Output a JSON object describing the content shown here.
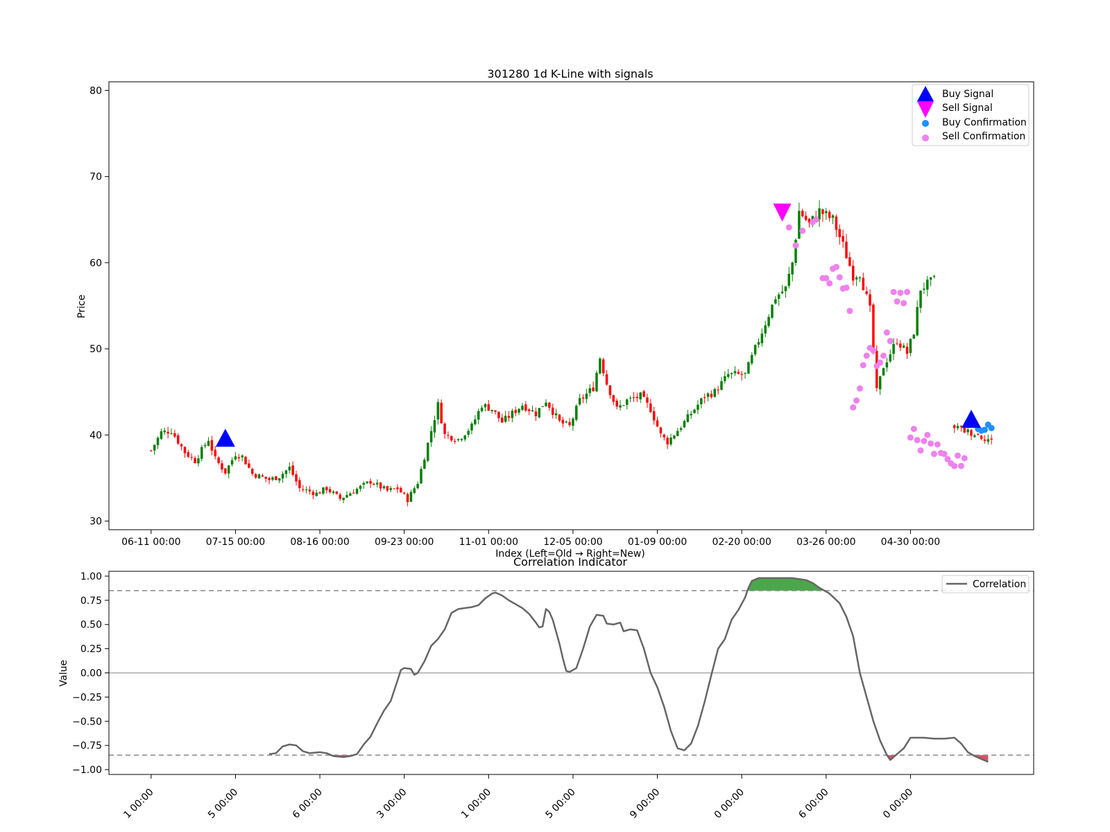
{
  "chart_data": [
    {
      "type": "candlestick",
      "title": "301280 1d K-Line with signals",
      "xlabel": "Index (Left=Old → Right=New)",
      "ylabel": "Price",
      "ylim": [
        29,
        81
      ],
      "yticks": [
        30,
        40,
        50,
        60,
        70,
        80
      ],
      "xticks": [
        {
          "i": 0,
          "label": "06-11 00:00"
        },
        {
          "i": 25,
          "label": "07-15 00:00"
        },
        {
          "i": 50,
          "label": "08-16 00:00"
        },
        {
          "i": 75,
          "label": "09-23 00:00"
        },
        {
          "i": 100,
          "label": "11-01 00:00"
        },
        {
          "i": 125,
          "label": "12-05 00:00"
        },
        {
          "i": 150,
          "label": "01-09 00:00"
        },
        {
          "i": 175,
          "label": "02-20 00:00"
        },
        {
          "i": 200,
          "label": "03-26 00:00"
        },
        {
          "i": 225,
          "label": "04-30 00:00"
        }
      ],
      "xlim": [
        -12.5,
        261.5
      ],
      "candle_count": 250,
      "candle_anchors": [
        [
          0,
          38.2
        ],
        [
          3,
          40.3
        ],
        [
          6,
          40.5
        ],
        [
          10,
          38
        ],
        [
          13,
          37
        ],
        [
          17,
          39.5
        ],
        [
          19,
          37.2
        ],
        [
          22,
          35.7
        ],
        [
          25,
          37.8
        ],
        [
          27,
          37.5
        ],
        [
          30,
          35.5
        ],
        [
          35,
          34.8
        ],
        [
          38,
          35.2
        ],
        [
          41,
          36.2
        ],
        [
          44,
          33.8
        ],
        [
          49,
          33.2
        ],
        [
          52,
          33.8
        ],
        [
          56,
          32.6
        ],
        [
          60,
          33.5
        ],
        [
          65,
          34.6
        ],
        [
          70,
          33.5
        ],
        [
          73,
          33.8
        ],
        [
          76,
          32.5
        ],
        [
          79,
          34.5
        ],
        [
          82,
          39
        ],
        [
          85,
          43.5
        ],
        [
          87,
          40
        ],
        [
          91,
          39.5
        ],
        [
          95,
          41
        ],
        [
          98,
          43.5
        ],
        [
          101,
          43
        ],
        [
          104,
          41.5
        ],
        [
          107,
          42.5
        ],
        [
          110,
          43.5
        ],
        [
          114,
          42.5
        ],
        [
          117,
          44
        ],
        [
          121,
          41.5
        ],
        [
          124,
          41
        ],
        [
          127,
          44
        ],
        [
          131,
          45.5
        ],
        [
          133,
          49
        ],
        [
          135,
          46
        ],
        [
          138,
          43
        ],
        [
          141,
          44
        ],
        [
          145,
          44.5
        ],
        [
          148,
          43
        ],
        [
          151,
          40
        ],
        [
          153,
          39.2
        ],
        [
          157,
          41
        ],
        [
          160,
          42.5
        ],
        [
          164,
          44.5
        ],
        [
          167,
          45
        ],
        [
          171,
          47
        ],
        [
          176,
          47
        ],
        [
          181,
          52
        ],
        [
          185,
          56
        ],
        [
          188,
          57
        ],
        [
          190,
          60
        ],
        [
          192,
          66
        ],
        [
          195,
          64.5
        ],
        [
          198,
          66
        ],
        [
          202,
          65
        ],
        [
          205,
          62
        ],
        [
          208,
          58.5
        ],
        [
          210,
          58.8
        ],
        [
          213,
          54.5
        ],
        [
          215,
          45
        ],
        [
          217,
          48
        ],
        [
          221,
          51
        ],
        [
          224,
          49.5
        ],
        [
          226,
          52
        ],
        [
          228,
          57
        ],
        [
          232,
          58
        ],
        [
          234,
          52
        ],
        [
          238,
          41
        ],
        [
          241,
          40.5
        ],
        [
          245,
          40
        ],
        [
          248,
          39.5
        ],
        [
          252,
          38.5
        ],
        [
          255,
          39
        ],
        [
          259,
          38.5
        ]
      ],
      "gaps": [
        [
          233,
          237
        ]
      ],
      "signals": {
        "buy_signal": [
          [
            22,
            39.6
          ],
          [
            243,
            41.8
          ]
        ],
        "sell_signal": [
          [
            187,
            65.9
          ]
        ],
        "buy_confirmation": [
          [
            245,
            40.7
          ],
          [
            246,
            40.5
          ],
          [
            247,
            40.6
          ],
          [
            248,
            41.2
          ],
          [
            249,
            40.8
          ]
        ],
        "sell_confirmation": [
          [
            189,
            64.1
          ],
          [
            191,
            62
          ],
          [
            193,
            63.7
          ],
          [
            196,
            64.7
          ],
          [
            197,
            65
          ],
          [
            199,
            58.2
          ],
          [
            200,
            58.2
          ],
          [
            201,
            57.6
          ],
          [
            202,
            59.3
          ],
          [
            203,
            59.5
          ],
          [
            204,
            58.3
          ],
          [
            205,
            57
          ],
          [
            206,
            57.1
          ],
          [
            207,
            54.4
          ],
          [
            208,
            43.2
          ],
          [
            209,
            44
          ],
          [
            210,
            45.4
          ],
          [
            211,
            48.1
          ],
          [
            212,
            49.2
          ],
          [
            213,
            50.1
          ],
          [
            214,
            49.8
          ],
          [
            215,
            48
          ],
          [
            216,
            48.4
          ],
          [
            217,
            49.2
          ],
          [
            218,
            51.9
          ],
          [
            219,
            50.9
          ],
          [
            220,
            56.6
          ],
          [
            221,
            55.5
          ],
          [
            222,
            56.5
          ],
          [
            223,
            55.3
          ],
          [
            224,
            56.6
          ],
          [
            225,
            39.7
          ],
          [
            226,
            40.7
          ],
          [
            227,
            39.4
          ],
          [
            228,
            38.2
          ],
          [
            229,
            39.3
          ],
          [
            230,
            40
          ],
          [
            231,
            39
          ],
          [
            232,
            37.8
          ],
          [
            233,
            38.9
          ],
          [
            234,
            37.9
          ],
          [
            235,
            37.8
          ],
          [
            236,
            37.2
          ],
          [
            237,
            36.7
          ],
          [
            238,
            36.4
          ],
          [
            239,
            37.6
          ],
          [
            240,
            36.4
          ],
          [
            241,
            37.3
          ]
        ]
      },
      "legend": {
        "placement": "top-right",
        "entries": [
          "Buy Signal",
          "Sell Signal",
          "Buy Confirmation",
          "Sell Confirmation"
        ]
      },
      "colors": {
        "up": "#008000",
        "down": "#ff0000",
        "buy_signal": "#0000ff",
        "sell_signal": "#ff00ff",
        "buy_confirmation": "#1e90ff",
        "sell_confirmation": "#ee82ee"
      }
    },
    {
      "type": "line",
      "title": "Correlation Indicator",
      "ylabel": "Value",
      "ylim": [
        -1.05,
        1.05
      ],
      "yticks": [
        {
          "v": 1.0,
          "label": "1.00"
        },
        {
          "v": 0.75,
          "label": "0.75"
        },
        {
          "v": 0.5,
          "label": "0.50"
        },
        {
          "v": 0.25,
          "label": "0.25"
        },
        {
          "v": 0.0,
          "label": "0.00"
        },
        {
          "v": -0.25,
          "label": "−0.25"
        },
        {
          "v": -0.5,
          "label": "−0.50"
        },
        {
          "v": -0.75,
          "label": "−0.75"
        },
        {
          "v": -1.0,
          "label": "−1.00"
        }
      ],
      "xlim": [
        -12.5,
        261.5
      ],
      "xticks": [
        {
          "i": 0,
          "label": "1 00:00"
        },
        {
          "i": 25,
          "label": "5 00:00"
        },
        {
          "i": 50,
          "label": "6 00:00"
        },
        {
          "i": 75,
          "label": "3 00:00"
        },
        {
          "i": 100,
          "label": "1 00:00"
        },
        {
          "i": 125,
          "label": "5 00:00"
        },
        {
          "i": 150,
          "label": "9 00:00"
        },
        {
          "i": 175,
          "label": "0 00:00"
        },
        {
          "i": 200,
          "label": "6 00:00"
        },
        {
          "i": 225,
          "label": "0 00:00"
        }
      ],
      "thresholds": [
        0.85,
        -0.85
      ],
      "zero_line": 0,
      "series": [
        {
          "name": "Correlation",
          "color": "#666666",
          "points": [
            [
              35,
              -0.84
            ],
            [
              37,
              -0.83
            ],
            [
              39,
              -0.76
            ],
            [
              41,
              -0.74
            ],
            [
              43,
              -0.75
            ],
            [
              45,
              -0.81
            ],
            [
              47,
              -0.83
            ],
            [
              50,
              -0.82
            ],
            [
              52,
              -0.83
            ],
            [
              54,
              -0.86
            ],
            [
              57,
              -0.87
            ],
            [
              59,
              -0.86
            ],
            [
              61,
              -0.84
            ],
            [
              63,
              -0.74
            ],
            [
              65,
              -0.66
            ],
            [
              67,
              -0.52
            ],
            [
              69,
              -0.39
            ],
            [
              71,
              -0.29
            ],
            [
              73,
              -0.08
            ],
            [
              74,
              0.03
            ],
            [
              75,
              0.05
            ],
            [
              77,
              0.04
            ],
            [
              78,
              -0.02
            ],
            [
              79,
              0.0
            ],
            [
              81,
              0.12
            ],
            [
              83,
              0.28
            ],
            [
              85,
              0.35
            ],
            [
              87,
              0.45
            ],
            [
              89,
              0.62
            ],
            [
              91,
              0.66
            ],
            [
              93,
              0.67
            ],
            [
              95,
              0.68
            ],
            [
              97,
              0.7
            ],
            [
              99,
              0.77
            ],
            [
              101,
              0.82
            ],
            [
              102,
              0.83
            ],
            [
              104,
              0.8
            ],
            [
              106,
              0.75
            ],
            [
              108,
              0.71
            ],
            [
              110,
              0.67
            ],
            [
              112,
              0.61
            ],
            [
              114,
              0.52
            ],
            [
              115,
              0.47
            ],
            [
              116,
              0.48
            ],
            [
              117,
              0.66
            ],
            [
              118,
              0.63
            ],
            [
              119,
              0.55
            ],
            [
              121,
              0.3
            ],
            [
              122,
              0.15
            ],
            [
              123,
              0.02
            ],
            [
              124,
              0.01
            ],
            [
              126,
              0.05
            ],
            [
              128,
              0.25
            ],
            [
              130,
              0.48
            ],
            [
              132,
              0.6
            ],
            [
              134,
              0.59
            ],
            [
              135,
              0.51
            ],
            [
              137,
              0.5
            ],
            [
              139,
              0.52
            ],
            [
              140,
              0.43
            ],
            [
              142,
              0.45
            ],
            [
              144,
              0.44
            ],
            [
              146,
              0.25
            ],
            [
              148,
              0.0
            ],
            [
              150,
              -0.15
            ],
            [
              152,
              -0.35
            ],
            [
              154,
              -0.6
            ],
            [
              156,
              -0.78
            ],
            [
              158,
              -0.8
            ],
            [
              160,
              -0.73
            ],
            [
              162,
              -0.55
            ],
            [
              164,
              -0.3
            ],
            [
              166,
              -0.02
            ],
            [
              168,
              0.25
            ],
            [
              170,
              0.35
            ],
            [
              172,
              0.55
            ],
            [
              174,
              0.65
            ],
            [
              176,
              0.78
            ],
            [
              177,
              0.88
            ],
            [
              178,
              0.95
            ],
            [
              180,
              0.98
            ],
            [
              185,
              0.98
            ],
            [
              190,
              0.98
            ],
            [
              194,
              0.96
            ],
            [
              196,
              0.93
            ],
            [
              198,
              0.88
            ],
            [
              201,
              0.82
            ],
            [
              204,
              0.72
            ],
            [
              206,
              0.58
            ],
            [
              208,
              0.38
            ],
            [
              210,
              0.0
            ],
            [
              212,
              -0.25
            ],
            [
              214,
              -0.5
            ],
            [
              216,
              -0.7
            ],
            [
              218,
              -0.85
            ],
            [
              219,
              -0.9
            ],
            [
              221,
              -0.84
            ],
            [
              223,
              -0.78
            ],
            [
              225,
              -0.67
            ],
            [
              229,
              -0.67
            ],
            [
              232,
              -0.68
            ],
            [
              235,
              -0.68
            ],
            [
              238,
              -0.67
            ],
            [
              240,
              -0.73
            ],
            [
              242,
              -0.82
            ],
            [
              244,
              -0.86
            ],
            [
              246,
              -0.89
            ],
            [
              248,
              -0.92
            ]
          ]
        }
      ],
      "fill_above": {
        "threshold": 0.85,
        "color": "#4ca64c"
      },
      "fill_below": {
        "threshold": -0.85,
        "color": "#e0505f"
      },
      "legend": {
        "placement": "top-right",
        "entries": [
          "Correlation"
        ]
      }
    }
  ]
}
